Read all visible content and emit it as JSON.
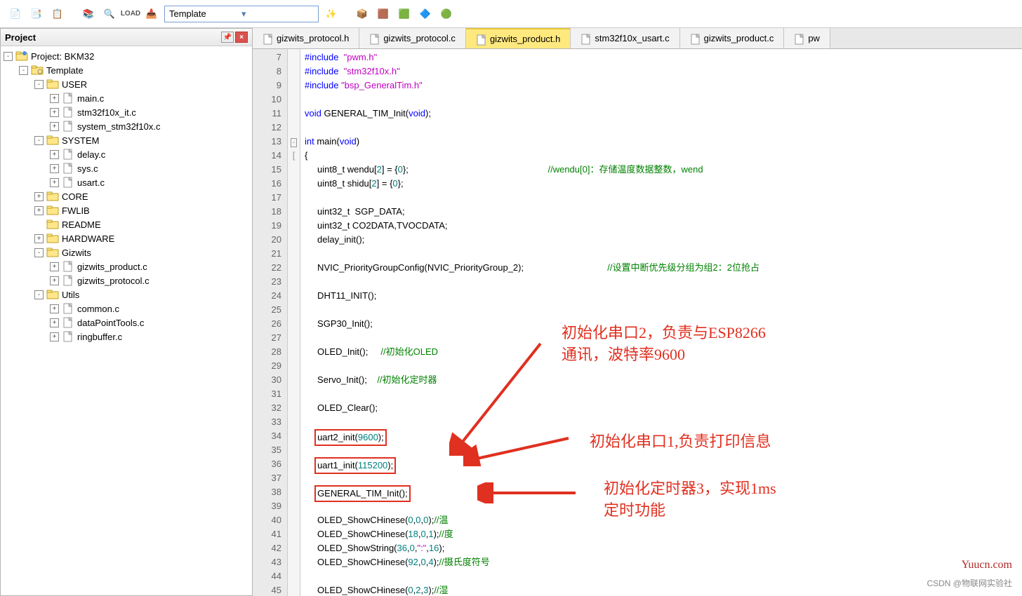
{
  "toolbar": {
    "combo_value": "Template"
  },
  "sidebar": {
    "title": "Project",
    "tree": [
      {
        "depth": 0,
        "exp": "-",
        "icon": "proj",
        "label": "Project: BKM32"
      },
      {
        "depth": 1,
        "exp": "-",
        "icon": "folder-gear",
        "label": "Template"
      },
      {
        "depth": 2,
        "exp": "-",
        "icon": "folder",
        "label": "USER"
      },
      {
        "depth": 3,
        "exp": "+",
        "icon": "file",
        "label": "main.c"
      },
      {
        "depth": 3,
        "exp": "+",
        "icon": "file",
        "label": "stm32f10x_it.c"
      },
      {
        "depth": 3,
        "exp": "+",
        "icon": "file",
        "label": "system_stm32f10x.c"
      },
      {
        "depth": 2,
        "exp": "-",
        "icon": "folder",
        "label": "SYSTEM"
      },
      {
        "depth": 3,
        "exp": "+",
        "icon": "file",
        "label": "delay.c"
      },
      {
        "depth": 3,
        "exp": "+",
        "icon": "file",
        "label": "sys.c"
      },
      {
        "depth": 3,
        "exp": "+",
        "icon": "file",
        "label": "usart.c"
      },
      {
        "depth": 2,
        "exp": "+",
        "icon": "folder",
        "label": "CORE"
      },
      {
        "depth": 2,
        "exp": "+",
        "icon": "folder",
        "label": "FWLIB"
      },
      {
        "depth": 2,
        "exp": " ",
        "icon": "folder",
        "label": "README"
      },
      {
        "depth": 2,
        "exp": "+",
        "icon": "folder",
        "label": "HARDWARE"
      },
      {
        "depth": 2,
        "exp": "-",
        "icon": "folder",
        "label": "Gizwits"
      },
      {
        "depth": 3,
        "exp": "+",
        "icon": "file",
        "label": "gizwits_product.c"
      },
      {
        "depth": 3,
        "exp": "+",
        "icon": "file",
        "label": "gizwits_protocol.c"
      },
      {
        "depth": 2,
        "exp": "-",
        "icon": "folder",
        "label": "Utils"
      },
      {
        "depth": 3,
        "exp": "+",
        "icon": "file",
        "label": "common.c"
      },
      {
        "depth": 3,
        "exp": "+",
        "icon": "file",
        "label": "dataPointTools.c"
      },
      {
        "depth": 3,
        "exp": "+",
        "icon": "file",
        "label": "ringbuffer.c"
      }
    ]
  },
  "tabs": [
    {
      "label": "gizwits_protocol.h",
      "active": false
    },
    {
      "label": "gizwits_protocol.c",
      "active": false
    },
    {
      "label": "gizwits_product.h",
      "active": true
    },
    {
      "label": "stm32f10x_usart.c",
      "active": false
    },
    {
      "label": "gizwits_product.c",
      "active": false
    },
    {
      "label": "pw",
      "active": false
    }
  ],
  "code": {
    "first_line": 7,
    "lines": [
      {
        "html": "<span class='kw'>#include</span>  <span class='str'>\"pwm.h\"</span>"
      },
      {
        "html": "<span class='kw'>#include</span>  <span class='str'>\"stm32f10x.h\"</span>"
      },
      {
        "html": "<span class='kw'>#include</span> <span class='str'>\"bsp_GeneralTim.h\"</span>"
      },
      {
        "html": ""
      },
      {
        "html": "<span class='kw'>void</span> GENERAL_TIM_Init(<span class='kw'>void</span>);"
      },
      {
        "html": ""
      },
      {
        "html": "<span class='kw'>int</span> main(<span class='kw'>void</span>)",
        "fold": "-"
      },
      {
        "html": "{",
        "fold": "["
      },
      {
        "html": "     uint8_t wendu[<span class='num'>2</span>] = {<span class='num'>0</span>};                                                       <span class='cmt'>//wendu[0]：存储温度数据整数，wend</span>"
      },
      {
        "html": "     uint8_t shidu[<span class='num'>2</span>] = {<span class='num'>0</span>};"
      },
      {
        "html": ""
      },
      {
        "html": "     uint32_t  SGP_DATA;"
      },
      {
        "html": "     uint32_t CO2DATA,TVOCDATA;"
      },
      {
        "html": "     delay_init();"
      },
      {
        "html": ""
      },
      {
        "html": "     NVIC_PriorityGroupConfig(NVIC_PriorityGroup_2);                                 <span class='cmt'>//设置中断优先级分组为组2：2位抢占</span>"
      },
      {
        "html": ""
      },
      {
        "html": "     DHT11_INIT();"
      },
      {
        "html": ""
      },
      {
        "html": "     SGP30_Init();"
      },
      {
        "html": ""
      },
      {
        "html": "     OLED_Init();     <span class='cmt'>//初始化OLED</span>"
      },
      {
        "html": ""
      },
      {
        "html": "     Servo_Init();    <span class='cmt'>//初始化定时器</span>"
      },
      {
        "html": ""
      },
      {
        "html": "     OLED_Clear();"
      },
      {
        "html": ""
      },
      {
        "html": "     <span class='box-red'>uart2_init(<span class='num'>9600</span>);</span>"
      },
      {
        "html": ""
      },
      {
        "html": "     <span class='box-red'>uart1_init(<span class='num'>115200</span>);</span>"
      },
      {
        "html": ""
      },
      {
        "html": "     <span class='box-red'>GENERAL_TIM_Init();</span>"
      },
      {
        "html": ""
      },
      {
        "html": "     OLED_ShowCHinese(<span class='num'>0</span>,<span class='num'>0</span>,<span class='num'>0</span>);<span class='cmt'>//温</span>"
      },
      {
        "html": "     OLED_ShowCHinese(<span class='num'>18</span>,<span class='num'>0</span>,<span class='num'>1</span>);<span class='cmt'>//度</span>"
      },
      {
        "html": "     OLED_ShowString(<span class='num'>36</span>,<span class='num'>0</span>,<span class='str'>\":\"</span>,<span class='num'>16</span>);"
      },
      {
        "html": "     OLED_ShowCHinese(<span class='num'>92</span>,<span class='num'>0</span>,<span class='num'>4</span>);<span class='cmt'>//摄氏度符号</span>"
      },
      {
        "html": ""
      },
      {
        "html": "     OLED_ShowCHinese(<span class='num'>0</span>,<span class='num'>2</span>,<span class='num'>3</span>);<span class='cmt'>//湿</span>"
      }
    ]
  },
  "annotations": {
    "a1": "初始化串口2，负责与ESP8266\n通讯，波特率9600",
    "a2": "初始化串口1,负责打印信息",
    "a3": "初始化定时器3，实现1ms\n定时功能"
  },
  "watermark": "Yuucn.com",
  "credit": "CSDN @物联网实验社"
}
